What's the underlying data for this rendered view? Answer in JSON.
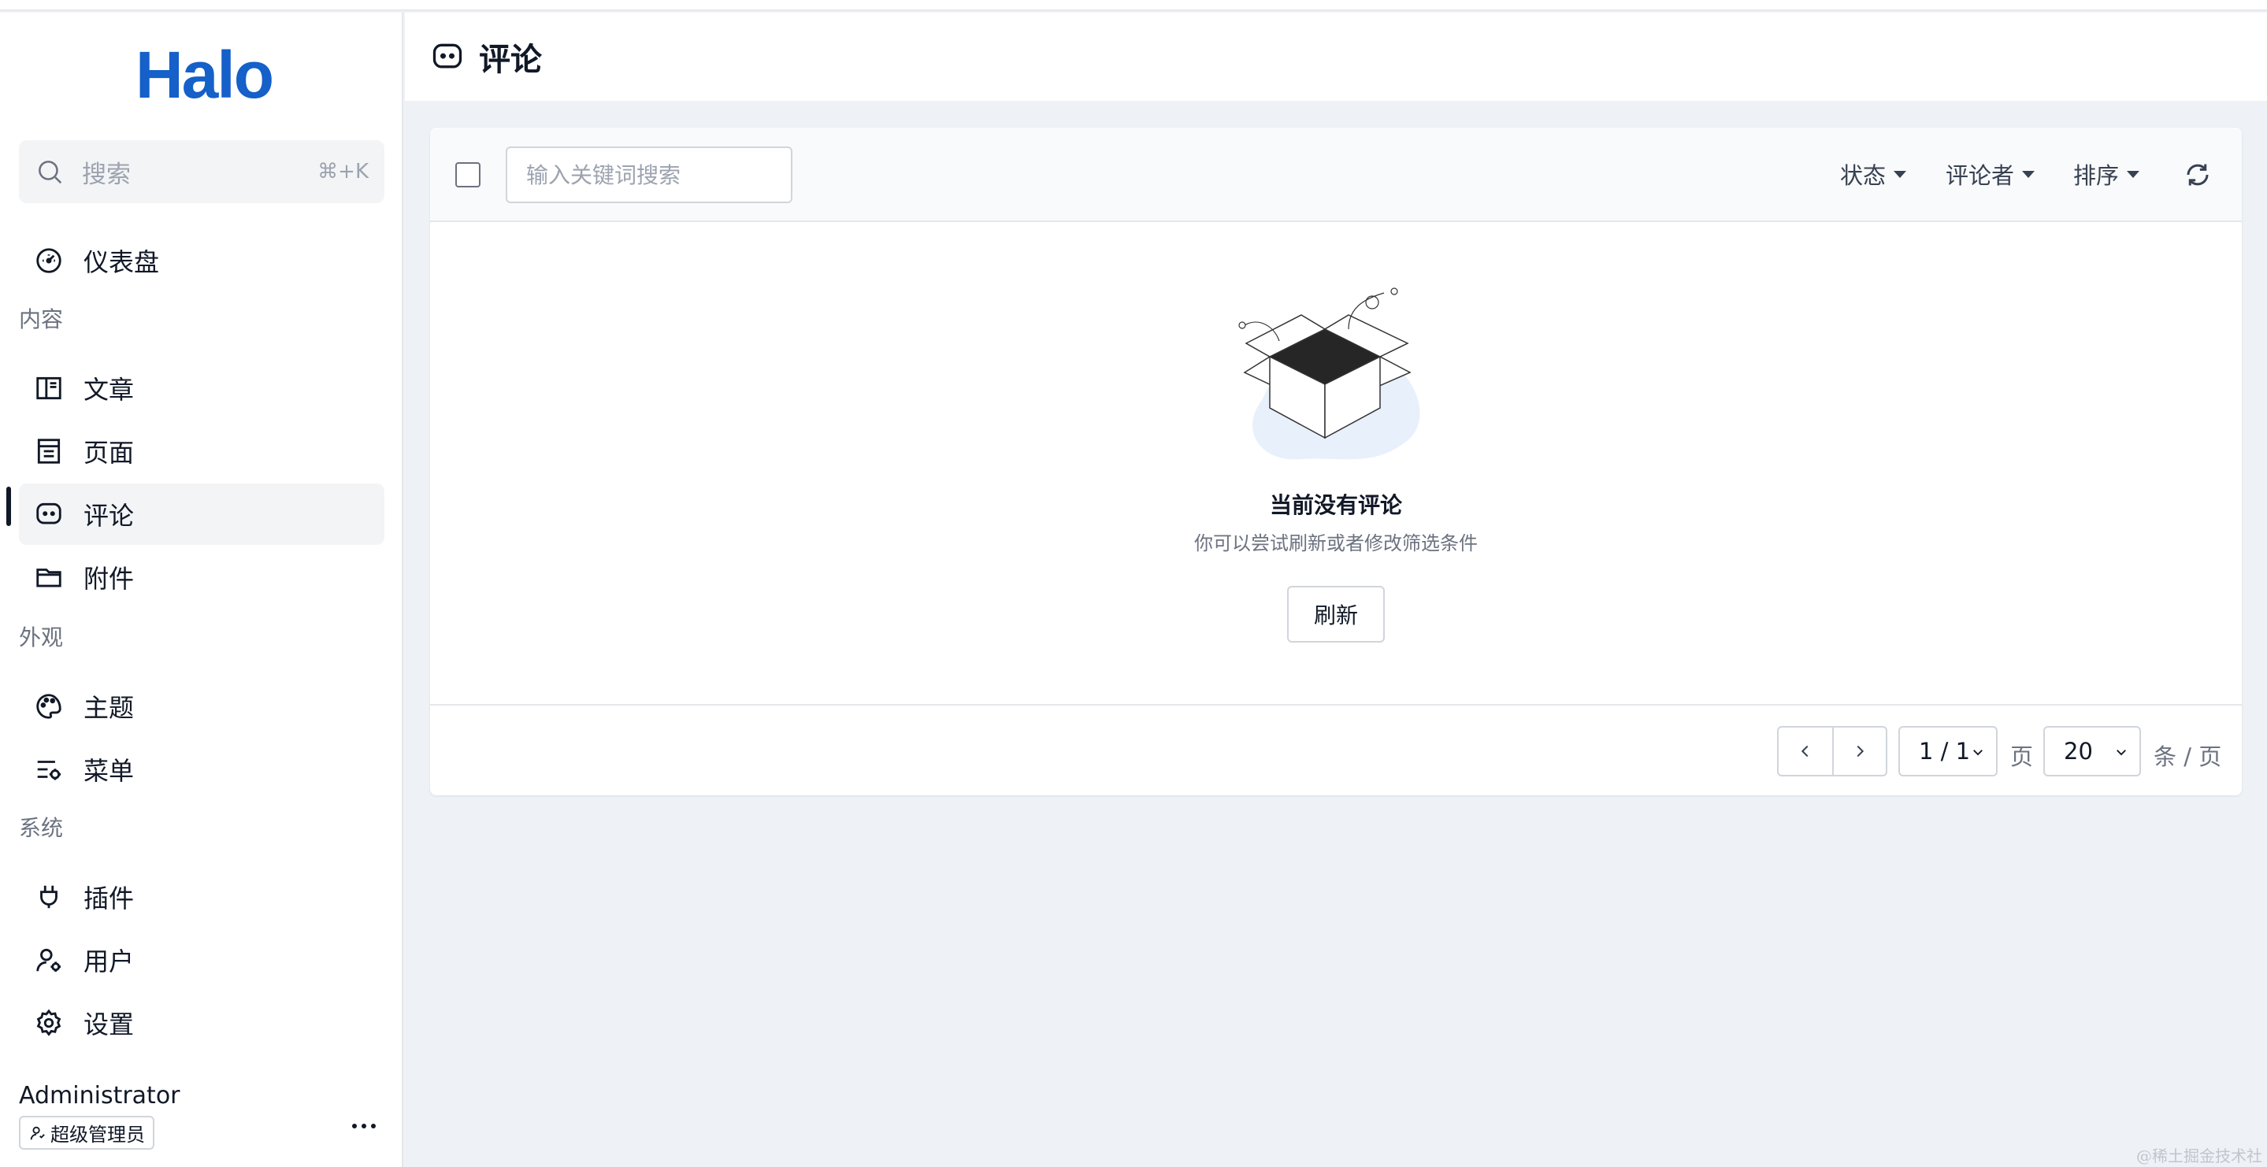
{
  "app": {
    "logo": "Halo",
    "accent": "#1560c9"
  },
  "sidebar": {
    "search": {
      "placeholder": "搜索",
      "shortcut": "⌘+K"
    },
    "dashboard": "仪表盘",
    "groups": {
      "content": "内容",
      "appearance": "外观",
      "system": "系统"
    },
    "items": {
      "posts": "文章",
      "pages": "页面",
      "comments": "评论",
      "attachments": "附件",
      "themes": "主题",
      "menus": "菜单",
      "plugins": "插件",
      "users": "用户",
      "settings": "设置"
    },
    "active": "comments",
    "user": {
      "name": "Administrator",
      "role": "超级管理员"
    }
  },
  "header": {
    "title": "评论",
    "icon": "comment-icon"
  },
  "toolbar": {
    "keyword_placeholder": "输入关键词搜索",
    "filters": {
      "status": "状态",
      "commenter": "评论者",
      "sort": "排序"
    }
  },
  "empty": {
    "title": "当前没有评论",
    "subtitle": "你可以尝试刷新或者修改筛选条件",
    "refresh_label": "刷新"
  },
  "pagination": {
    "page": "1 / 1",
    "page_unit": "页",
    "size": "20",
    "size_unit": "条 / 页"
  },
  "watermark": "@稀土掘金技术社区"
}
